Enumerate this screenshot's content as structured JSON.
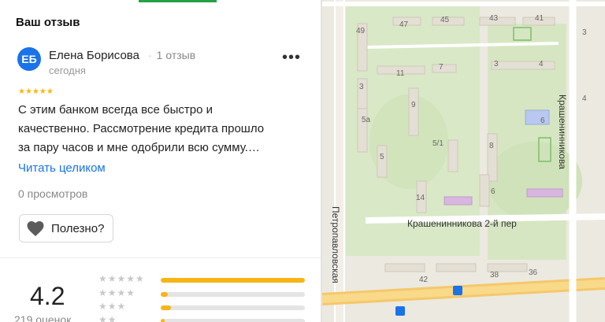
{
  "review": {
    "section_title": "Ваш отзыв",
    "avatar_initials": "ЕБ",
    "author_name": "Елена Борисова",
    "author_reviews": "1 отзыв",
    "date": "сегодня",
    "more_label": "•••",
    "rating_stars": 5,
    "stars_text": "★★★★★",
    "text_lines": [
      "С этим банком всегда все быстро и",
      "качественно. Рассмотрение кредита прошло",
      "за пару часов и мне одобрили всю сумму.…"
    ],
    "read_more": "Читать целиком",
    "views": "0 просмотров",
    "useful_label": "Полезно?"
  },
  "rating_summary": {
    "value": "4.2",
    "count_text": "219 оценок",
    "bars": [
      {
        "stars": "★★★★★",
        "fraction": 1.0
      },
      {
        "stars": "★★★★",
        "fraction": 0.05
      },
      {
        "stars": "★★★",
        "fraction": 0.07
      },
      {
        "stars": "★★",
        "fraction": 0.03
      }
    ]
  },
  "map": {
    "street_labels": [
      "Краше­нинникова",
      "Крашенинникова 2-й пер",
      "Петропавловская"
    ],
    "house_numbers": [
      "49",
      "47",
      "45",
      "43",
      "41",
      "11",
      "7",
      "3",
      "4",
      "3",
      "9",
      "6",
      "5а",
      "5",
      "5/1",
      "8",
      "14",
      "6",
      "42",
      "38",
      "36",
      "3",
      "4"
    ]
  },
  "colors": {
    "accent_blue": "#1a73e8",
    "star_gold": "#ffb60a",
    "bar_yellow": "#f7b515",
    "tab_green": "#25a244"
  }
}
